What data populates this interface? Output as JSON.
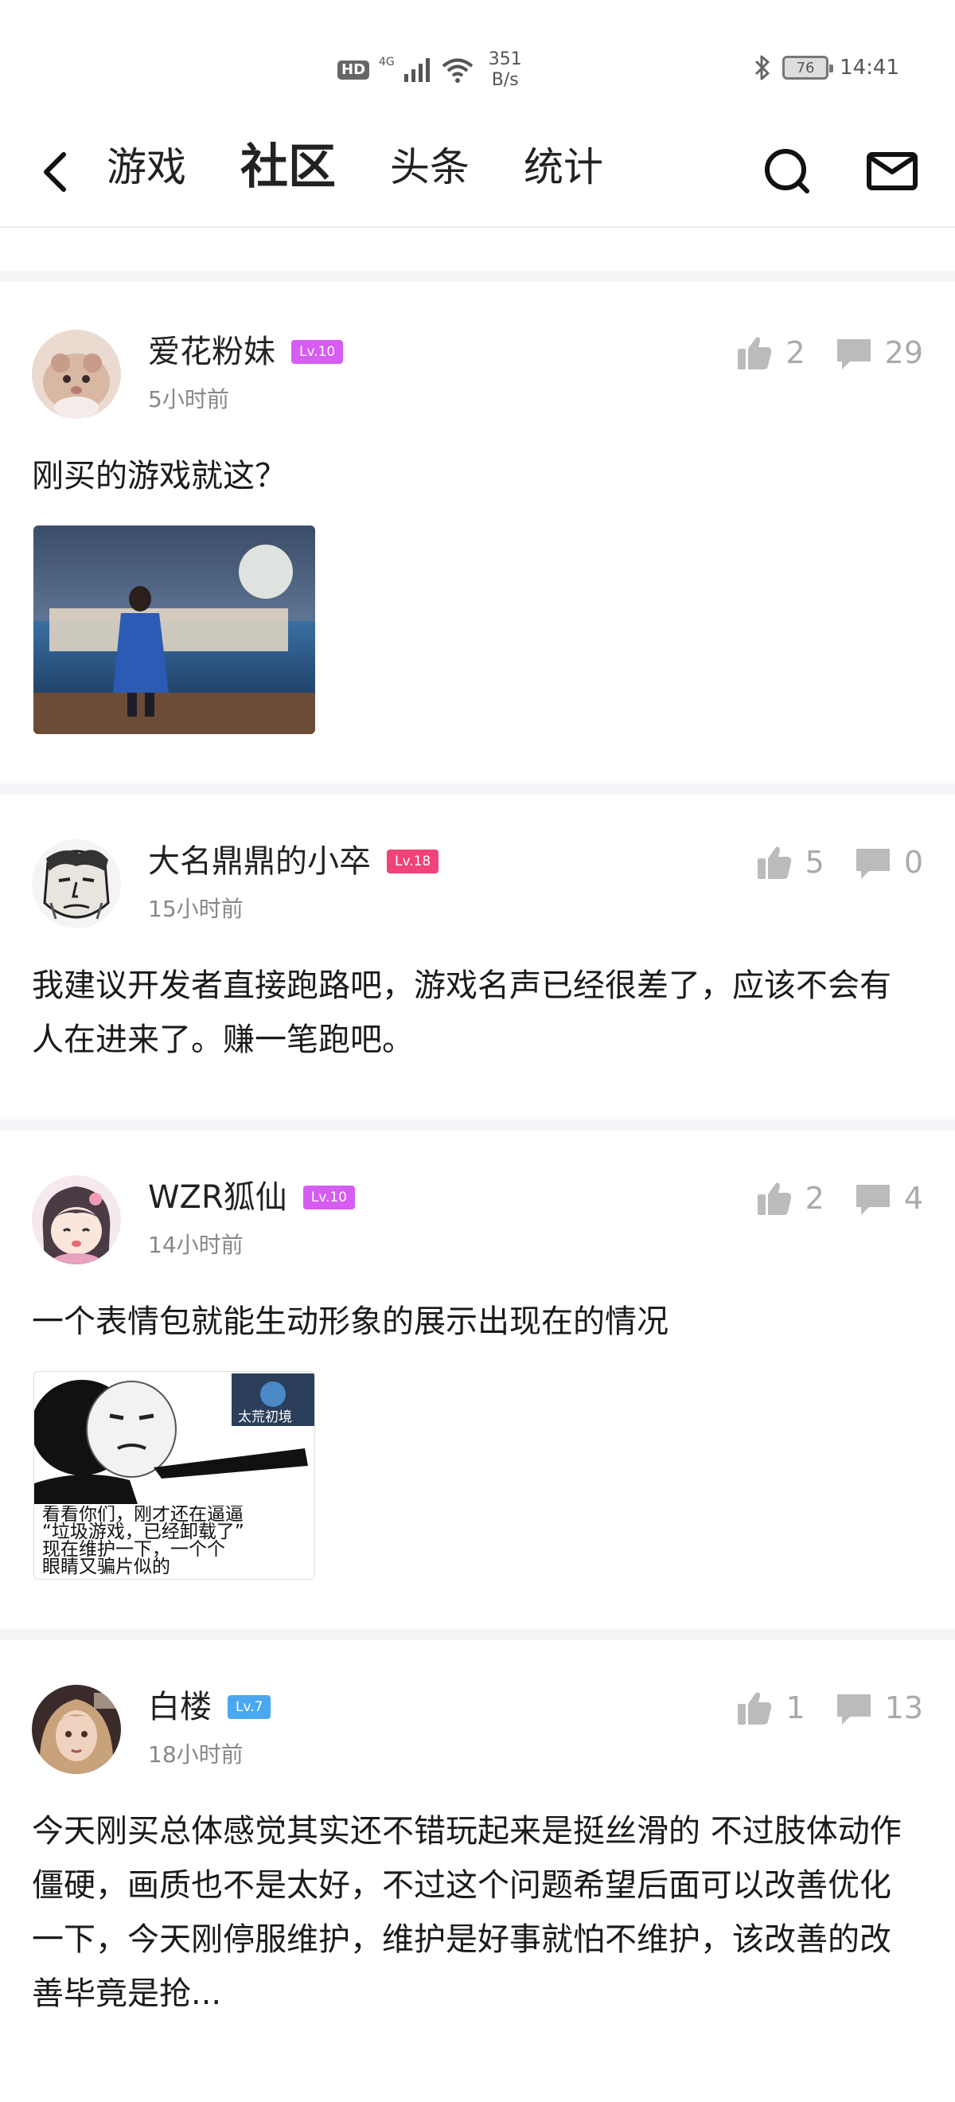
{
  "status_bar": {
    "hd": "HD",
    "network": "4G",
    "speed_value": "351",
    "speed_unit": "B/s",
    "battery": "76",
    "time": "14:41"
  },
  "nav": {
    "tabs": [
      {
        "label": "游戏",
        "active": false
      },
      {
        "label": "社区",
        "active": true
      },
      {
        "label": "头条",
        "active": false
      },
      {
        "label": "统计",
        "active": false
      }
    ]
  },
  "posts": [
    {
      "username": "爱花粉妹",
      "level": "Lv.10",
      "level_color": "#d65cf2",
      "time": "5小时前",
      "likes": "2",
      "comments": "29",
      "text": "刚买的游戏就这？"
    },
    {
      "username": "大名鼎鼎的小卒",
      "level": "Lv.18",
      "level_color": "#f0437a",
      "time": "15小时前",
      "likes": "5",
      "comments": "0",
      "text": "我建议开发者直接跑路吧，游戏名声已经很差了，应该不会有人在进来了。赚一笔跑吧。"
    },
    {
      "username": "WZR狐仙",
      "level": "Lv.10",
      "level_color": "#d65cf2",
      "time": "14小时前",
      "likes": "2",
      "comments": "4",
      "text": "一个表情包就能生动形象的展示出现在的情况",
      "meme_badge": "太荒初境",
      "meme_caption": "看看你们，刚才还在逼逼\n“垃圾游戏，已经卸载了”\n现在维护一下，一个个\n眼睛又骗片似的"
    },
    {
      "username": "白楼",
      "level": "Lv.7",
      "level_color": "#4aa8f0",
      "time": "18小时前",
      "likes": "1",
      "comments": "13",
      "text": "今天刚买总体感觉其实还不错玩起来是挺丝滑的 不过肢体动作僵硬，画质也不是太好，不过这个问题希望后面可以改善优化一下，今天刚停服维护，维护是好事就怕不维护，该改善的改善毕竟是抢..."
    }
  ]
}
